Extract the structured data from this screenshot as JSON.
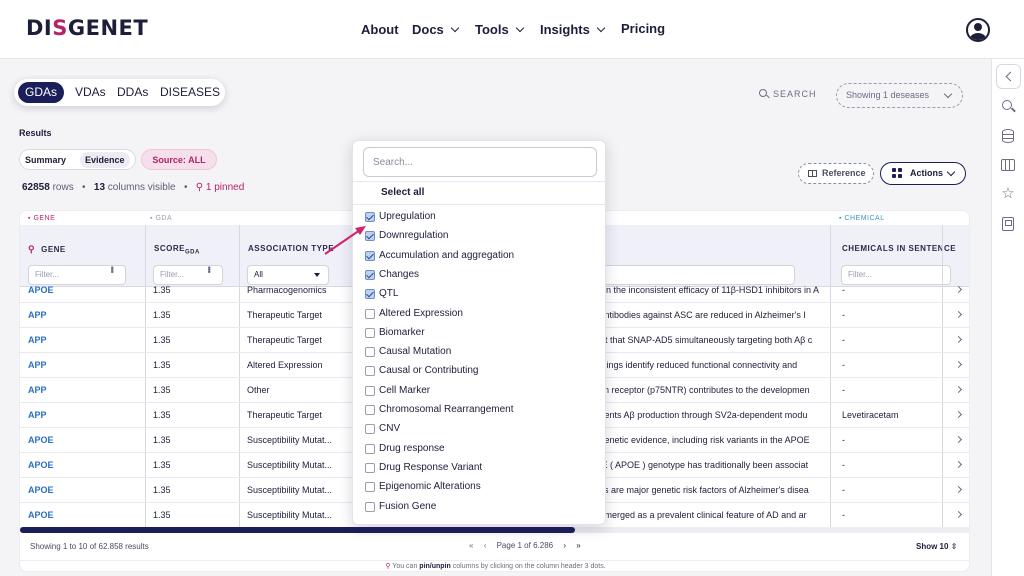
{
  "brand": {
    "prefix": "DI",
    "slash": "S",
    "suffix": "GENET",
    "accent": "#b3236b"
  },
  "nav": {
    "about": "About",
    "docs": "Docs",
    "tools": "Tools",
    "insights": "Insights",
    "pricing": "Pricing"
  },
  "type_tabs": [
    "GDAs",
    "VDAs",
    "DDAs",
    "DISEASES"
  ],
  "search": {
    "label": "SEARCH",
    "showing": "Showing 1 deseases"
  },
  "results": {
    "heading": "Results",
    "view_summary": "Summary",
    "view_evidence": "Evidence",
    "source": "Source: ALL",
    "rows_count": "62858",
    "rows_label": "rows",
    "columns_count": "13",
    "columns_label": "columns visible",
    "pinned": "1 pinned"
  },
  "actions": {
    "reference": "Reference",
    "actions": "Actions"
  },
  "table": {
    "groups": {
      "gene": "GENE",
      "gda": "GDA",
      "chemical": "CHEMICAL"
    },
    "headers": {
      "gene": "GENE",
      "score": "SCORE",
      "score_sub": "GDA",
      "assoc": "ASSOCIATION TYPE",
      "chem": "CHEMICALS IN SENTENCE"
    },
    "filter_placeholder": "Filter...",
    "assoc_selected": "All",
    "rows": [
      {
        "gene": "APOE",
        "score": "1.35",
        "assoc": "Pharmacogenomics",
        "sentence": "plain the inconsistent efficacy of 11β-HSD1 inhibitors in A",
        "chem": "-"
      },
      {
        "gene": "APP",
        "score": "1.35",
        "assoc": "Therapeutic Target",
        "sentence": "g antibodies against ASC are reduced in Alzheimer's I",
        "chem": "-"
      },
      {
        "gene": "APP",
        "score": "1.35",
        "assoc": "Therapeutic Target",
        "sentence": "port that SNAP-AD5 simultaneously targeting both Aβ c",
        "chem": "-"
      },
      {
        "gene": "APP",
        "score": "1.35",
        "assoc": "Altered Expression",
        "sentence": "findings identify reduced functional connectivity and",
        "chem": "-"
      },
      {
        "gene": "APP",
        "score": "1.35",
        "assoc": "Other",
        "sentence": "phin receptor (p75NTR) contributes to the developmen",
        "chem": "-"
      },
      {
        "gene": "APP",
        "score": "1.35",
        "assoc": "Therapeutic Target",
        "sentence": "revents Aβ production through SV2a-dependent modu",
        "chem": "Levetiracetam"
      },
      {
        "gene": "APOE",
        "score": "1.35",
        "assoc": "Susceptibility Mutat...",
        "sentence": "g genetic evidence, including risk variants in the APOE",
        "chem": "-"
      },
      {
        "gene": "APOE",
        "score": "1.35",
        "assoc": "Susceptibility Mutat...",
        "sentence": "in E ( APOE ) genotype has traditionally been associat",
        "chem": "-"
      },
      {
        "gene": "APOE",
        "score": "1.35",
        "assoc": "Susceptibility Mutat...",
        "sentence": "sms are major genetic risk factors of Alzheimer's disea",
        "chem": "-"
      },
      {
        "gene": "APOE",
        "score": "1.35",
        "assoc": "Susceptibility Mutat...",
        "sentence": "o emerged as a prevalent clinical feature of AD and ar",
        "chem": "-"
      }
    ]
  },
  "footer": {
    "showing": "Showing 1 to 10 of 62.858 results",
    "first": "«",
    "prev": "‹",
    "page": "Page 1 of 6.286",
    "next": "›",
    "last": "»",
    "show": "Show 10",
    "hint_pre": "You can",
    "hint_bold": "pin/unpin",
    "hint_post": "columns by clicking on the column header 3 dots."
  },
  "dropdown": {
    "placeholder": "Search...",
    "select_all": "Select all",
    "options": [
      {
        "label": "Upregulation",
        "checked": true
      },
      {
        "label": "Downregulation",
        "checked": true
      },
      {
        "label": "Accumulation and aggregation",
        "checked": true
      },
      {
        "label": "Changes",
        "checked": true
      },
      {
        "label": "QTL",
        "checked": true
      },
      {
        "label": "Altered Expression",
        "checked": false
      },
      {
        "label": "Biomarker",
        "checked": false
      },
      {
        "label": "Causal Mutation",
        "checked": false
      },
      {
        "label": "Causal or Contributing",
        "checked": false
      },
      {
        "label": "Cell Marker",
        "checked": false
      },
      {
        "label": "Chromosomal Rearrangement",
        "checked": false
      },
      {
        "label": "CNV",
        "checked": false
      },
      {
        "label": "Drug response",
        "checked": false
      },
      {
        "label": "Drug Response Variant",
        "checked": false
      },
      {
        "label": "Epigenomic Alterations",
        "checked": false
      },
      {
        "label": "Fusion Gene",
        "checked": false
      }
    ]
  },
  "icons": [
    "user-icon",
    "collapse-icon",
    "search-icon",
    "database-icon",
    "columns-icon",
    "star-icon",
    "book-icon",
    "pin-icon",
    "reference-icon",
    "actions-grid-icon"
  ]
}
